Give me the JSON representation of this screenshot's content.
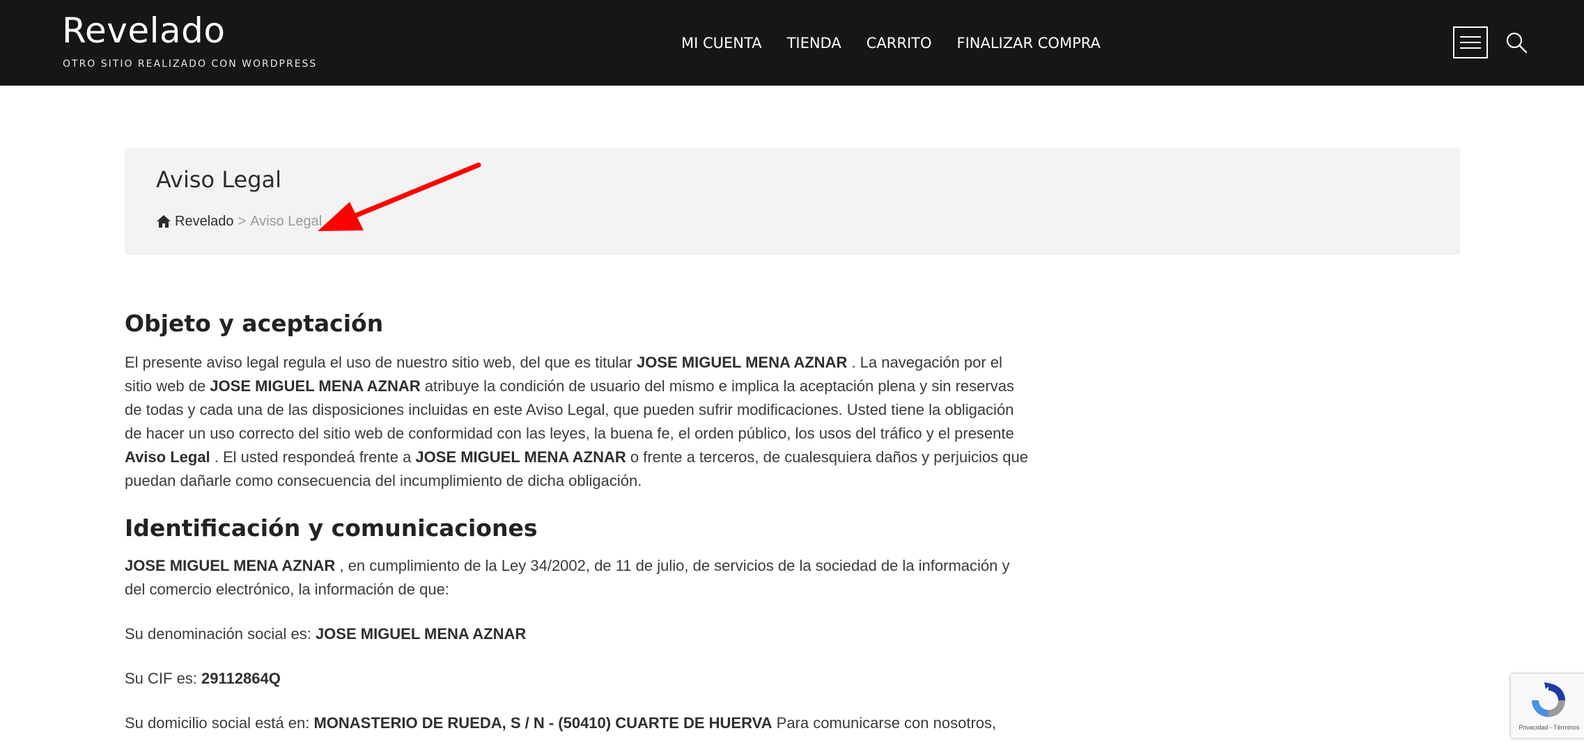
{
  "site": {
    "title": "Revelado",
    "tagline": "OTRO SITIO REALIZADO CON WORDPRESS"
  },
  "nav": [
    {
      "label": "MI CUENTA"
    },
    {
      "label": "TIENDA"
    },
    {
      "label": "CARRITO"
    },
    {
      "label": "FINALIZAR COMPRA"
    }
  ],
  "icons": {
    "menu": "hamburger-menu-icon",
    "search": "search-icon",
    "home": "home-icon"
  },
  "banner": {
    "title": "Aviso Legal",
    "breadcrumb": {
      "home": "Revelado",
      "separator": ">",
      "current": "Aviso Legal"
    }
  },
  "colors": {
    "header_bg": "#161616",
    "banner_bg": "#f3f3f3",
    "annotation_arrow": "#ff0000"
  },
  "sections": {
    "objeto": {
      "title": "Objeto y aceptación",
      "p1": "El presente aviso legal regula el uso de nuestro sitio web, del que es titular ",
      "b1": "JOSE MIGUEL MENA AZNAR",
      "p2": " . La navegación por el sitio web de ",
      "b2": "JOSE MIGUEL MENA AZNAR",
      "p3": " atribuye la condición de usuario del mismo e implica la aceptación plena y sin reservas de todas y cada una de las disposiciones incluidas en este Aviso Legal, que pueden sufrir modificaciones. Usted tiene la obligación de hacer un uso correcto del sitio web de conformidad con las leyes, la buena fe, el orden público, los usos del tráfico y el presente ",
      "b3": "Aviso Legal",
      "p4": " . El usted respondeá frente a ",
      "b4": "JOSE MIGUEL MENA AZNAR",
      "p5": " o frente a terceros, de cualesquiera daños y perjuicios que puedan dañarle como consecuencia del incumplimiento de dicha obligación."
    },
    "identificacion": {
      "title": "Identificación y comunicaciones",
      "b1": "JOSE MIGUEL MENA AZNAR",
      "p1": " , en cumplimiento de la Ley 34/2002, de 11 de julio, de servicios de la sociedad de la información y del comercio electrónico, la información de que:",
      "denominacion_label": "Su denominación social es: ",
      "denominacion_value": "JOSE MIGUEL MENA AZNAR",
      "cif_label": "Su CIF es: ",
      "cif_value": "29112864Q",
      "domicilio_label": "Su domicilio social está en: ",
      "domicilio_value": "MONASTERIO DE RUEDA, S / N - (50410) CUARTE DE HUERVA",
      "domicilio_tail": " Para comunicarse con nosotros,"
    }
  },
  "recaptcha": {
    "links": "Privacidad - Términos"
  }
}
